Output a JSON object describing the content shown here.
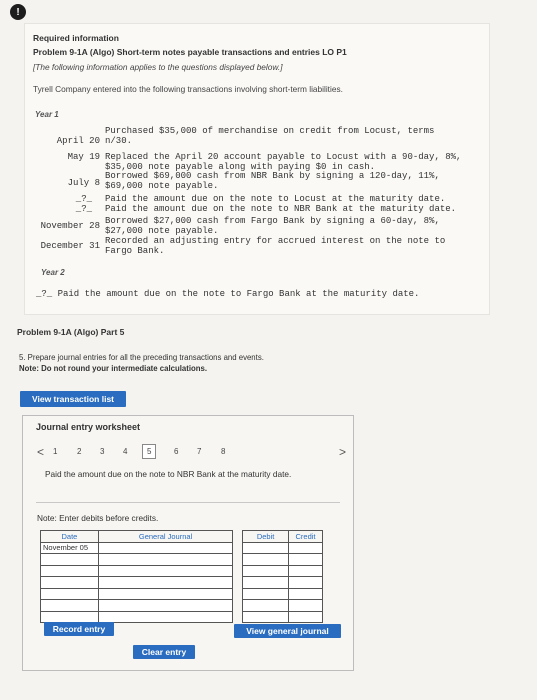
{
  "alert_icon": "!",
  "header": {
    "required": "Required information",
    "problem": "Problem 9-1A (Algo) Short-term notes payable transactions and entries LO P1",
    "info_note": "[The following information applies to the questions displayed below.]",
    "intro": "Tyrell Company entered into the following transactions involving short-term liabilities."
  },
  "year1": {
    "label": "Year 1",
    "transactions": [
      {
        "date": "April 20",
        "lines": [
          "Purchased $35,000 of merchandise on credit from Locust, terms",
          "n/30."
        ]
      },
      {
        "date": "May 19",
        "lines": [
          "Replaced the April 20 account payable to Locust with a 90-day, 8%,",
          "$35,000 note payable along with paying $0 in cash."
        ]
      },
      {
        "date": "July 8",
        "lines": [
          "Borrowed $69,000 cash from NBR Bank by signing a 120-day, 11%,",
          "$69,000 note payable."
        ]
      },
      {
        "date": "_?_",
        "lines": [
          "Paid the amount due on the note to Locust at the maturity date."
        ]
      },
      {
        "date": "_?_",
        "lines": [
          "Paid the amount due on the note to NBR Bank at the maturity date."
        ]
      },
      {
        "date": "November 28",
        "lines": [
          "Borrowed $27,000 cash from Fargo Bank by signing a 60-day, 8%,",
          "$27,000 note payable."
        ]
      },
      {
        "date": "December 31",
        "lines": [
          "Recorded an adjusting entry for accrued interest on the note to",
          "Fargo Bank."
        ]
      }
    ]
  },
  "year2": {
    "label": "Year 2",
    "line": "_?_ Paid the amount due on the note to Fargo Bank at the maturity date."
  },
  "part": {
    "title": "Problem 9-1A (Algo) Part 5",
    "instruction": "5. Prepare journal entries for all the preceding transactions and events.",
    "note": "Note: Do not round your intermediate calculations."
  },
  "view_transaction_list": "View transaction list",
  "worksheet": {
    "title": "Journal entry worksheet",
    "prev_arrow": "<",
    "next_arrow": ">",
    "pages": [
      "1",
      "2",
      "3",
      "4",
      "5",
      "6",
      "7",
      "8"
    ],
    "active_page": "5",
    "description": "Paid the amount due on the note to NBR Bank at the maturity date.",
    "note_debits": "Note: Enter debits before credits.",
    "table": {
      "headers": {
        "date": "Date",
        "general_journal": "General Journal",
        "debit": "Debit",
        "credit": "Credit"
      },
      "first_date": "November 05",
      "row_count": 7
    },
    "record_entry": "Record entry",
    "clear_entry": "Clear entry",
    "view_general_journal": "View general journal"
  }
}
